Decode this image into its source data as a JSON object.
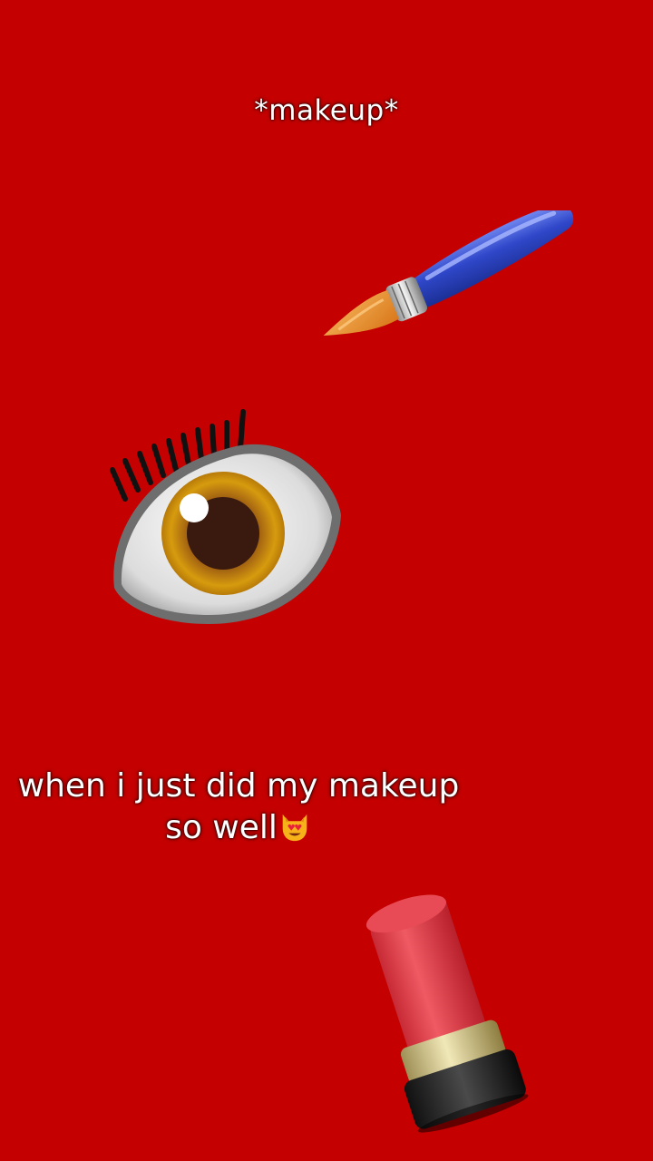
{
  "overlay": {
    "top_caption": "*makeup*",
    "main_caption_line1": "when i just did my makeup",
    "main_caption_line2": "so well"
  },
  "stickers": {
    "brush": "paintbrush-icon",
    "eye": "eye-icon",
    "lipstick": "lipstick-icon",
    "inline_emoji": "heart-eyes-cat-icon"
  },
  "colors": {
    "background": "#c40000",
    "text": "#ffffff"
  }
}
